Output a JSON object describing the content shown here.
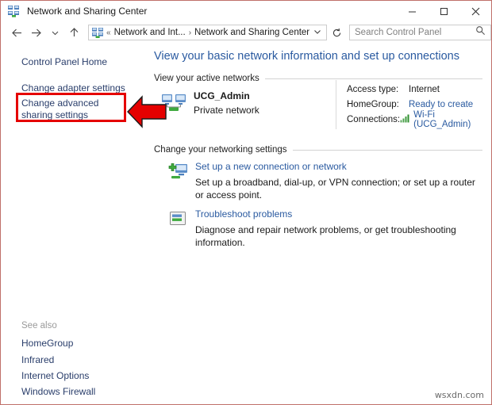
{
  "window": {
    "title": "Network and Sharing Center",
    "icon": "network-icon",
    "controls": {
      "minimize": "minimize-icon",
      "maximize": "maximize-icon",
      "close": "close-icon"
    }
  },
  "navbar": {
    "back": "back-arrow-icon",
    "forward": "forward-arrow-icon",
    "recent": "chevron-down-icon",
    "up": "up-arrow-icon",
    "address_icon": "network-icon",
    "breadcrumb": {
      "overflow": "«",
      "parent": "Network and Int...",
      "separator": "›",
      "current": "Network and Sharing Center",
      "dropdown": "chevron-down-icon"
    },
    "refresh": "refresh-icon",
    "search": {
      "placeholder": "Search Control Panel",
      "value": "",
      "icon": "search-icon"
    }
  },
  "sidebar": {
    "control_panel_home": "Control Panel Home",
    "change_adapter_settings": "Change adapter settings",
    "change_advanced_sharing_settings": "Change advanced sharing settings",
    "see_also_label": "See also",
    "see_also": [
      "HomeGroup",
      "Infrared",
      "Internet Options",
      "Windows Firewall"
    ]
  },
  "main": {
    "page_title": "View your basic network information and set up connections",
    "active_networks_heading": "View your active networks",
    "active_network": {
      "name": "UCG_Admin",
      "type": "Private network",
      "icon": "network-status-icon",
      "details": [
        {
          "key": "Access type:",
          "value": "Internet",
          "link": false
        },
        {
          "key": "HomeGroup:",
          "value": "Ready to create",
          "link": true
        },
        {
          "key": "Connections:",
          "value": "Wi-Fi (UCG_Admin)",
          "link": true,
          "icon": "wifi-signal-icon"
        }
      ]
    },
    "change_settings_heading": "Change your networking settings",
    "tasks": [
      {
        "icon": "new-connection-icon",
        "link": "Set up a new connection or network",
        "description": "Set up a broadband, dial-up, or VPN connection; or set up a router or access point."
      },
      {
        "icon": "troubleshoot-icon",
        "link": "Troubleshoot problems",
        "description": "Diagnose and repair network problems, or get troubleshooting information."
      }
    ]
  },
  "annotations": {
    "highlight_box": "red-highlight-box",
    "pointer_arrow": "red-left-arrow"
  },
  "watermark": "wsxdn.com",
  "colors": {
    "link": "#2a5aa0",
    "sidebar_link": "#2a3e6b",
    "annotation_red": "#e50000",
    "title_blue": "#2a5aa0"
  }
}
